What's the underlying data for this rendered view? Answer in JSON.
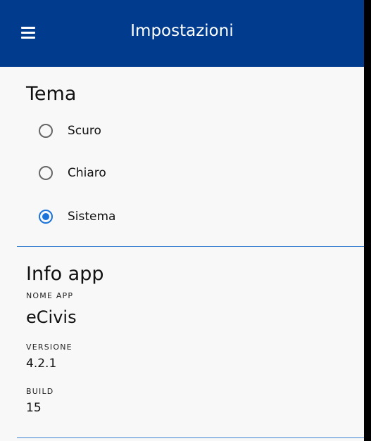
{
  "header": {
    "title": "Impostazioni",
    "menu_icon": "hamburger-menu-icon"
  },
  "theme": {
    "title": "Tema",
    "options": [
      {
        "label": "Scuro",
        "checked": false
      },
      {
        "label": "Chiaro",
        "checked": false
      },
      {
        "label": "Sistema",
        "checked": true
      }
    ]
  },
  "info": {
    "title": "Info app",
    "app_name_label": "NOME APP",
    "app_name": "eCivis",
    "version_label": "VERSIONE",
    "version": "4.2.1",
    "build_label": "BUILD",
    "build": "15"
  },
  "colors": {
    "appbar": "#003b8e",
    "accent": "#1a73d9",
    "divider": "#3c84cf"
  }
}
